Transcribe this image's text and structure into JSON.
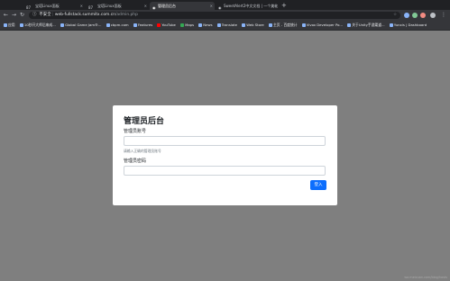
{
  "browser": {
    "tabs": [
      {
        "title": "宝塔Linux面板",
        "prefix": "87"
      },
      {
        "title": "宝塔Linux面板",
        "prefix": "87"
      },
      {
        "title": "管理员后台",
        "prefix": ""
      },
      {
        "title": "SweetAlert2中文文档 | 一个美化",
        "prefix": ""
      }
    ],
    "new_tab": "+",
    "url": {
      "security": "不安全",
      "host": "web-fullstack.summitx.com.cn",
      "path": "/admin.php"
    },
    "bookmarks": [
      "应用",
      "10秒开大师后来成...",
      "Global Game Jam®...",
      "cbpm.com",
      "Features",
      "YouTube",
      "Maps",
      "News",
      "Translate",
      "Web Store",
      "主页 - 百度统计",
      "Vivox Developer Po...",
      "关于Unity手游渠道...",
      "Yunxis | Dashboard"
    ]
  },
  "page": {
    "title": "管理员后台",
    "account_label": "管理员账号",
    "account_help": "请输入正确的管理员账号",
    "password_label": "管理员密码",
    "login_button": "登入"
  },
  "watermark": "wa.meixuan.com/blog/hosts"
}
